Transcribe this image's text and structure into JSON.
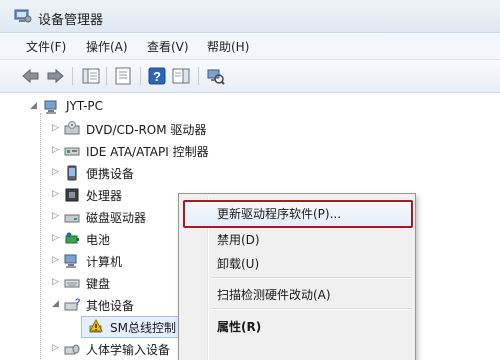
{
  "window": {
    "title": "设备管理器"
  },
  "menu": [
    "文件(F)",
    "操作(A)",
    "查看(V)",
    "帮助(H)"
  ],
  "toolbar": {
    "buttons": [
      "back-icon",
      "forward-icon",
      "show-hide-console-tree-icon",
      "properties-icon",
      "help-icon",
      "action-pane-icon",
      "scan-hardware-icon"
    ]
  },
  "tree": {
    "root": "JYT-PC",
    "items": [
      {
        "label": "DVD/CD-ROM 驱动器",
        "icon": "dvd-drive-icon"
      },
      {
        "label": "IDE ATA/ATAPI 控制器",
        "icon": "ide-controller-icon"
      },
      {
        "label": "便携设备",
        "icon": "portable-device-icon"
      },
      {
        "label": "处理器",
        "icon": "processor-icon"
      },
      {
        "label": "磁盘驱动器",
        "icon": "disk-drive-icon"
      },
      {
        "label": "电池",
        "icon": "battery-icon"
      },
      {
        "label": "计算机",
        "icon": "computer-icon"
      },
      {
        "label": "键盘",
        "icon": "keyboard-icon"
      },
      {
        "label": "其他设备",
        "icon": "other-devices-icon"
      }
    ],
    "child": {
      "label": "SM总线控制",
      "icon": "warning-device-icon"
    },
    "last_item": {
      "label": "人体学输入设备",
      "icon": "hid-icon"
    }
  },
  "context_menu": {
    "items": [
      {
        "label": "更新驱动程序软件(P)...",
        "highlighted": true
      },
      {
        "label": "禁用(D)"
      },
      {
        "label": "卸载(U)"
      },
      {
        "label": "扫描检测硬件改动(A)"
      },
      {
        "label": "属性(R)",
        "bold": true
      }
    ]
  },
  "colors": {
    "highlight_border": "#b01622",
    "warning": "#f2c000"
  }
}
